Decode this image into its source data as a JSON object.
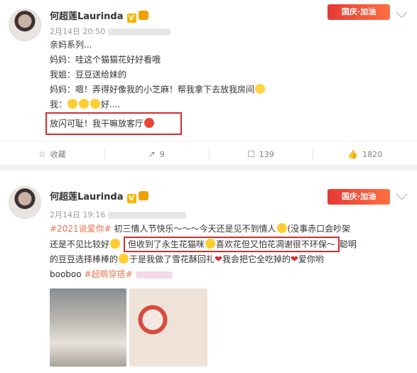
{
  "post1": {
    "user": "何超莲Laurinda",
    "time": "2月14日 20:50",
    "banner_text": "国庆·加油",
    "lines": [
      "亲妈系列...",
      "妈妈：哇这个猫猫花好好看哦",
      "我姐：豆豆送给妹的",
      "妈妈：嗯！弄得好像我的小芝麻！帮我拿下去放我房间",
      "我：",
      "好....",
      "放闪可耻！我干嘛放客厅"
    ],
    "actions": {
      "favorite": "收藏",
      "share": "9",
      "comment": "139",
      "like": "1820"
    }
  },
  "post2": {
    "user": "何超莲Laurinda",
    "time": "2月14日 19:16",
    "banner_text": "国庆·加油",
    "hashtag1": "#2021说爱你#",
    "t1": "初三情人节快乐～～～今天还是见不到情人",
    "t2": "(没事赤口会吵架",
    "t3": "还是不见比较好",
    "t4": "但收到了永生花猫咪",
    "t5": "喜欢花但又怕花凋谢很不环保～",
    "t6": "聪明",
    "t7": "的豆豆选择棒棒的",
    "t8": "于是我做了雪花酥回礼",
    "t9": "我会把它全吃掉的",
    "t10": "爱你哟",
    "t11": "booboo",
    "hashtag2": "#超萌穿搭#"
  },
  "colors": {
    "highlight": "#d32f2f",
    "link": "#eb7350"
  }
}
